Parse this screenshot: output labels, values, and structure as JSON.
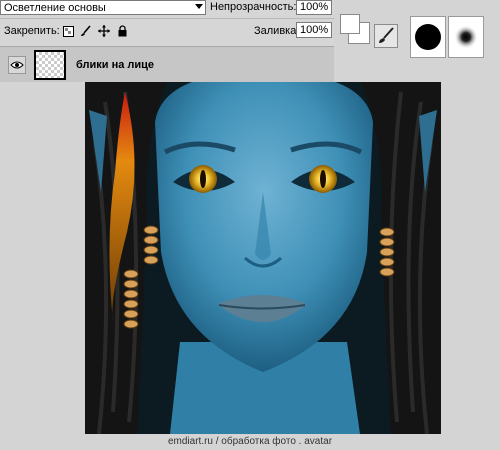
{
  "layers_panel": {
    "blend_mode": "Осветление основы",
    "opacity_label": "Непрозрачность:",
    "opacity_value": "100%",
    "lock_label": "Закрепить:",
    "fill_label": "Заливка:",
    "fill_value": "100%",
    "layer": {
      "name": "блики на лице",
      "visible": true
    }
  },
  "toolbar": {
    "icons": [
      "transparency-lock-icon",
      "brush-lock-icon",
      "move-lock-icon",
      "padlock-icon",
      "brush-tool-icon",
      "hard-brush-preset-icon",
      "soft-brush-preset-icon"
    ],
    "foreground_color": "#ffffff",
    "background_color": "#ffffff"
  },
  "canvas": {
    "skin_color": "#3f90b7",
    "eye_color": "#f2c230"
  },
  "caption": "emdiart.ru   / обработка фото . avatar"
}
